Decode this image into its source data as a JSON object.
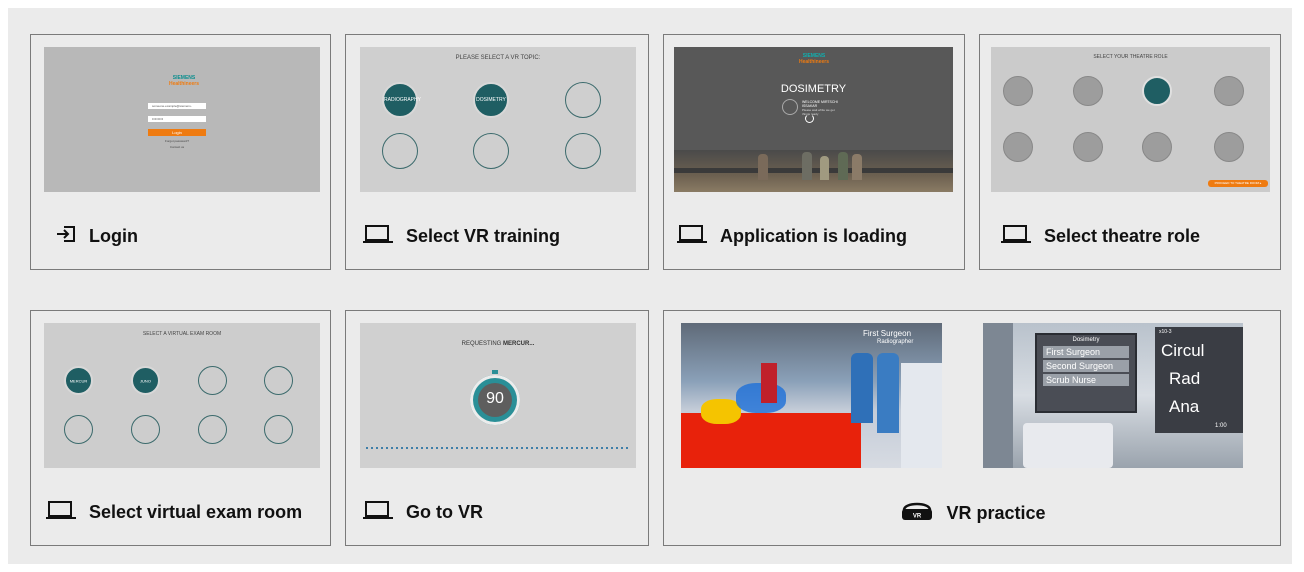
{
  "cards": {
    "login": {
      "caption": "Login",
      "icon": "login-icon",
      "screen": {
        "brand_top": "SIEMENS",
        "brand_bottom": "Healthineers",
        "email_value": "someone.example@siemens-healthineers.com",
        "password_value": "••••••••",
        "button_label": "Login",
        "forgot": "Forgot password?",
        "contact": "Contact us"
      }
    },
    "select_vr": {
      "caption": "Select VR training",
      "icon": "laptop-icon",
      "screen": {
        "title": "PLEASE SELECT A VR TOPIC:",
        "topics": [
          "RADIOGRAPHY",
          "DOSIMETRY"
        ]
      }
    },
    "loading": {
      "caption": "Application is loading",
      "icon": "laptop-icon",
      "screen": {
        "brand_top": "SIEMENS",
        "brand_bottom": "Healthineers",
        "heading": "DOSIMETRY",
        "welcome": "WELCOME MIRTSCHI ISSAKAR",
        "note": "Please wait while we get things ready"
      }
    },
    "theatre": {
      "caption": "Select theatre role",
      "icon": "laptop-icon",
      "screen": {
        "title": "SELECT YOUR THEATRE ROLE",
        "button_label": "PROCEED TO THEATRE ROOM ▸"
      }
    },
    "exam_room": {
      "caption": "Select virtual exam room",
      "icon": "laptop-icon",
      "screen": {
        "title": "SELECT A VIRTUAL EXAM ROOM",
        "rooms": [
          "MERCUR",
          "JUNO"
        ]
      }
    },
    "go_vr": {
      "caption": "Go to VR",
      "icon": "laptop-icon",
      "screen": {
        "title_prefix": "REQUESTING",
        "title_name": "MERCUR...",
        "timer": "90"
      }
    },
    "vr_practice": {
      "caption": "VR practice",
      "icon": "vr-headset-icon",
      "scene1": {
        "label_a": "First Surgeon",
        "label_b": "Radiographer"
      },
      "scene2": {
        "panel_title": "Dosimetry",
        "roles": [
          "First Surgeon",
          "Second Surgeon",
          "Scrub Nurse"
        ],
        "right_words": [
          "Circul",
          "Rad",
          "Ana"
        ],
        "axis_top": "x10-3",
        "axis_val": "1:00"
      }
    }
  },
  "colors": {
    "teal": "#1f5e63",
    "orange": "#ef7b10",
    "screen_gray": "#c9c9c9",
    "dark_screen": "#5a5a5a"
  }
}
